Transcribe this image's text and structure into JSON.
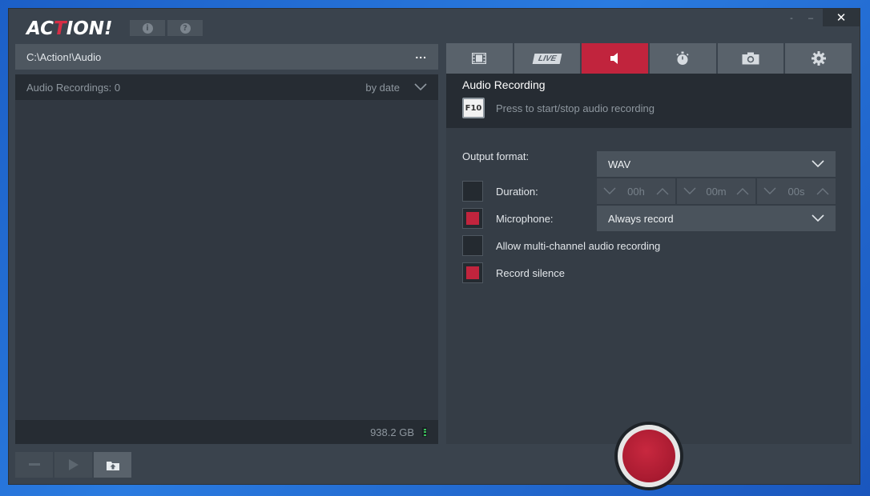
{
  "app": {
    "logo_main": "AC",
    "logo_red": "T",
    "logo_tail": "ION!",
    "info_icon": "i",
    "help_icon": "?",
    "close_glyph": "✕",
    "minimize_glyph": "–",
    "restore_glyph": "-"
  },
  "left": {
    "path": "C:\\Action!\\Audio",
    "path_menu": "...",
    "recordings_label": "Audio Recordings: 0",
    "sort_label": "by date",
    "free_space": "938.2 GB"
  },
  "tabs": [
    {
      "name": "video",
      "icon": "film-icon"
    },
    {
      "name": "live",
      "icon": "live-icon",
      "label": "LIVE"
    },
    {
      "name": "audio",
      "icon": "speaker-icon",
      "active": true
    },
    {
      "name": "benchmark",
      "icon": "stopwatch-icon"
    },
    {
      "name": "screenshot",
      "icon": "camera-icon"
    },
    {
      "name": "settings",
      "icon": "gear-icon"
    }
  ],
  "audio": {
    "title": "Audio Recording",
    "hotkey": "F10",
    "hotkey_text": "Press to start/stop audio recording",
    "output_format_label": "Output format:",
    "output_format_value": "WAV",
    "duration_label": "Duration:",
    "duration_h": "00h",
    "duration_m": "00m",
    "duration_s": "00s",
    "duration_checked": false,
    "microphone_label": "Microphone:",
    "microphone_checked": true,
    "microphone_value": "Always record",
    "multichannel_label": "Allow multi-channel audio recording",
    "multichannel_checked": false,
    "silence_label": "Record silence",
    "silence_checked": true
  },
  "colors": {
    "accent": "#c1243d",
    "panel": "#353d46",
    "background": "#3a434d"
  }
}
